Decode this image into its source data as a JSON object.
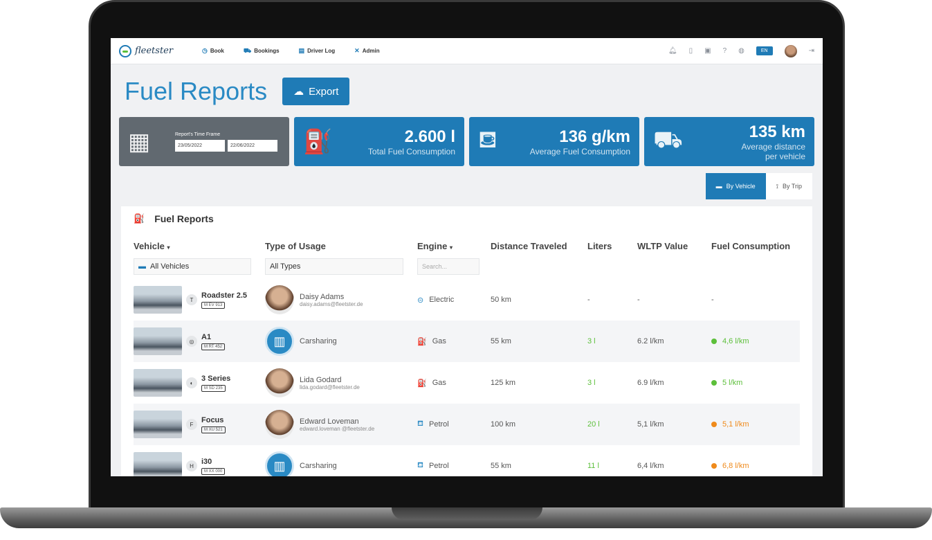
{
  "topbar": {
    "logo": "fleetster",
    "nav": [
      {
        "label": "Book",
        "icon": "clock-icon"
      },
      {
        "label": "Bookings",
        "icon": "car-icon"
      },
      {
        "label": "Driver Log",
        "icon": "logbook-icon"
      },
      {
        "label": "Admin",
        "icon": "wrench-icon"
      }
    ],
    "language": "EN"
  },
  "page": {
    "title": "Fuel Reports",
    "export_label": "Export"
  },
  "kpis": {
    "timeframe": {
      "label": "Report's Time Frame",
      "from": "23/05/2022",
      "to": "22/06/2022"
    },
    "total": {
      "value": "2.600 l",
      "label": "Total Fuel Consumption"
    },
    "average": {
      "value": "136 g/km",
      "label": "Average Fuel Consumption"
    },
    "distance": {
      "value": "135 km",
      "label_1": "Average distance",
      "label_2": "per vehicle"
    }
  },
  "view_toggle": {
    "by_vehicle": "By Vehicle",
    "by_trip": "By Trip"
  },
  "table": {
    "title": "Fuel Reports",
    "headers": {
      "vehicle": "Vehicle",
      "usage": "Type of Usage",
      "engine": "Engine",
      "distance": "Distance Traveled",
      "liters": "Liters",
      "wltp": "WLTP Value",
      "consumption": "Fuel Consumption"
    },
    "filters": {
      "vehicle": "All Vehicles",
      "usage": "All Types",
      "engine_placeholder": "Search..."
    },
    "rows": [
      {
        "vehicle": "Roadster 2.5",
        "plate": "M EV 913",
        "brand": "T",
        "user": "Daisy Adams",
        "email": "daisy.adams@fleetster.de",
        "engine": "Electric",
        "distance": "50 km",
        "liters": "-",
        "wltp": "-",
        "consumption": "-"
      },
      {
        "vehicle": "A1",
        "plate": "M RT 452",
        "brand": "◎",
        "user": "Carsharing",
        "email": "",
        "engine": "Gas",
        "distance": "55 km",
        "liters": "3 l",
        "wltp": "6.2 l/km",
        "consumption": "4,6 l/km"
      },
      {
        "vehicle": "3 Series",
        "plate": "M SD 235",
        "brand": "◐",
        "user": "Lida Godard",
        "email": "lida.godard@fleetster.de",
        "engine": "Gas",
        "distance": "125 km",
        "liters": "3 l",
        "wltp": "6.9 l/km",
        "consumption": "5 l/km"
      },
      {
        "vehicle": "Focus",
        "plate": "M XU 521",
        "brand": "F",
        "user": "Edward Loveman",
        "email": "edward.loveman @fleetster.de",
        "engine": "Petrol",
        "distance": "100 km",
        "liters": "20 l",
        "wltp": "5,1 l/km",
        "consumption": "5,1 l/km"
      },
      {
        "vehicle": "i30",
        "plate": "M XX 000",
        "brand": "H",
        "user": "Carsharing",
        "email": "",
        "engine": "Petrol",
        "distance": "55 km",
        "liters": "11 l",
        "wltp": "6,4 l/km",
        "consumption": "6,8 l/km"
      }
    ]
  },
  "colors": {
    "primary": "#1f7bb6",
    "ok": "#5cbf3a",
    "warn": "#ef8a1b"
  }
}
